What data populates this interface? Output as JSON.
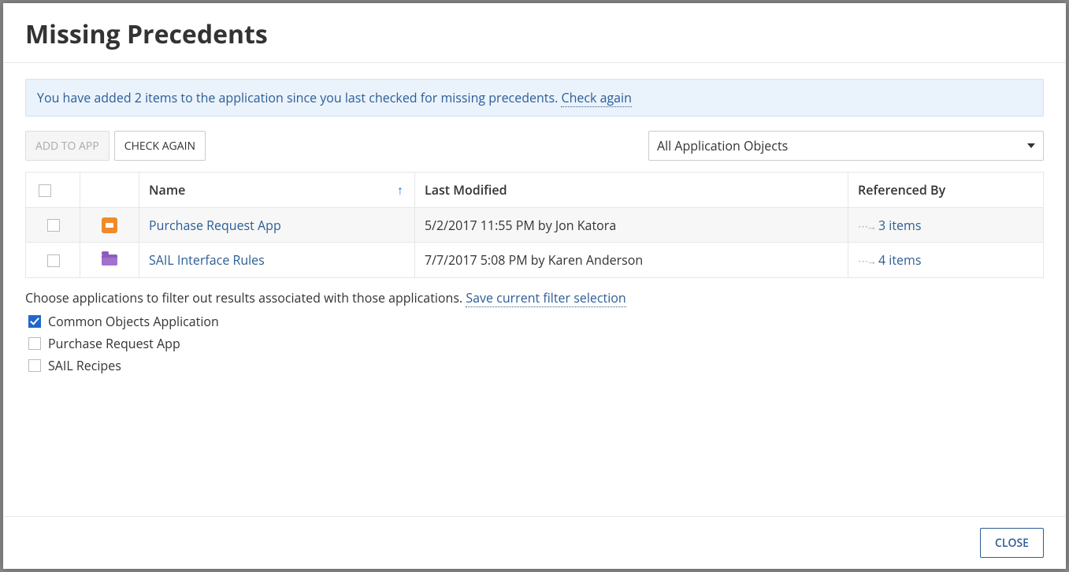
{
  "title": "Missing Precedents",
  "banner": {
    "text": "You have added 2 items to the application since you last checked for missing precedents. ",
    "link": "Check again"
  },
  "toolbar": {
    "add_label": "ADD TO APP",
    "check_label": "CHECK AGAIN",
    "select_value": "All Application Objects"
  },
  "columns": {
    "name": "Name",
    "last_modified": "Last Modified",
    "referenced_by": "Referenced By"
  },
  "rows": [
    {
      "icon": "app",
      "name": "Purchase Request App",
      "modified": "5/2/2017 11:55 PM by Jon Katora",
      "ref": "3 items"
    },
    {
      "icon": "folder",
      "name": "SAIL Interface Rules",
      "modified": "7/7/2017 5:08 PM by Karen Anderson",
      "ref": "4 items"
    }
  ],
  "filter": {
    "intro": "Choose applications to filter out results associated with those applications. ",
    "save_label": "Save current filter selection",
    "items": [
      {
        "label": "Common Objects Application",
        "checked": true
      },
      {
        "label": "Purchase Request App",
        "checked": false
      },
      {
        "label": "SAIL Recipes",
        "checked": false
      }
    ]
  },
  "footer": {
    "close_label": "CLOSE"
  }
}
